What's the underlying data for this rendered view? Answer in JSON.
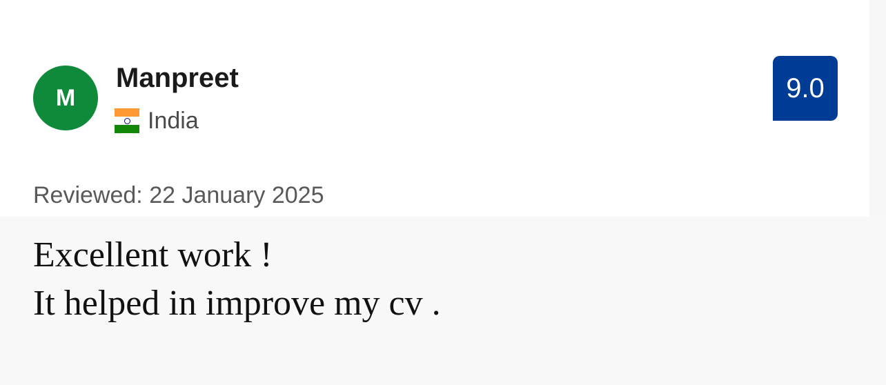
{
  "reviewer": {
    "initial": "M",
    "name": "Manpreet",
    "country": "India",
    "flag_icon": "india-flag-icon",
    "avatar_color": "#0f8a3b"
  },
  "score": {
    "value": "9.0",
    "color": "#003b95"
  },
  "review": {
    "date_label": "Reviewed: 22 January 2025",
    "text_lines": [
      "Excellent work !",
      "It helped in improve my cv ."
    ]
  }
}
